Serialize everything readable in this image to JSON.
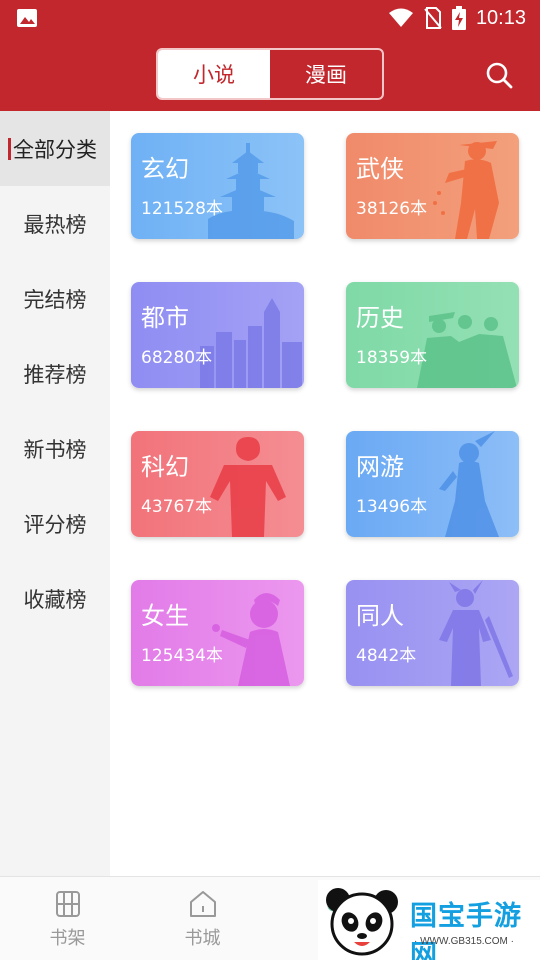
{
  "status_bar": {
    "time": "10:13"
  },
  "header": {
    "tabs": [
      {
        "label": "小说",
        "active": true
      },
      {
        "label": "漫画",
        "active": false
      }
    ],
    "accent_color": "#c1272d"
  },
  "sidebar": {
    "items": [
      {
        "label": "全部分类",
        "active": true
      },
      {
        "label": "最热榜"
      },
      {
        "label": "完结榜"
      },
      {
        "label": "推荐榜"
      },
      {
        "label": "新书榜"
      },
      {
        "label": "评分榜"
      },
      {
        "label": "收藏榜"
      }
    ]
  },
  "categories": [
    {
      "name": "玄幻",
      "count": "121528本",
      "color_from": "#6fb1f5",
      "color_to": "#8cc3f7",
      "art": "pagoda-silhouette"
    },
    {
      "name": "武侠",
      "count": "38126本",
      "color_from": "#f08a6a",
      "color_to": "#f3a07c",
      "art": "swordsman-silhouette"
    },
    {
      "name": "都市",
      "count": "68280本",
      "color_from": "#8f8df2",
      "color_to": "#a4a2f5",
      "art": "city-skyline-silhouette"
    },
    {
      "name": "历史",
      "count": "18359本",
      "color_from": "#7fd9a6",
      "color_to": "#94e0b5",
      "art": "soldiers-silhouette"
    },
    {
      "name": "科幻",
      "count": "43767本",
      "color_from": "#f2737a",
      "color_to": "#f48e93",
      "art": "armored-hero-silhouette"
    },
    {
      "name": "网游",
      "count": "13496本",
      "color_from": "#6aa9f4",
      "color_to": "#8dbef7",
      "art": "elf-girl-silhouette"
    },
    {
      "name": "女生",
      "count": "125434本",
      "color_from": "#e27be8",
      "color_to": "#ec98ef",
      "art": "girl-silhouette"
    },
    {
      "name": "同人",
      "count": "4842本",
      "color_from": "#9891f1",
      "color_to": "#aca6f4",
      "art": "warrior-silhouette"
    }
  ],
  "bottom_nav": {
    "items": [
      {
        "label": "书架",
        "icon": "bookshelf-icon"
      },
      {
        "label": "书城",
        "icon": "home-icon"
      }
    ]
  },
  "watermark": {
    "brand": "国宝手游网",
    "site": "· WWW.GB315.COM ·"
  }
}
